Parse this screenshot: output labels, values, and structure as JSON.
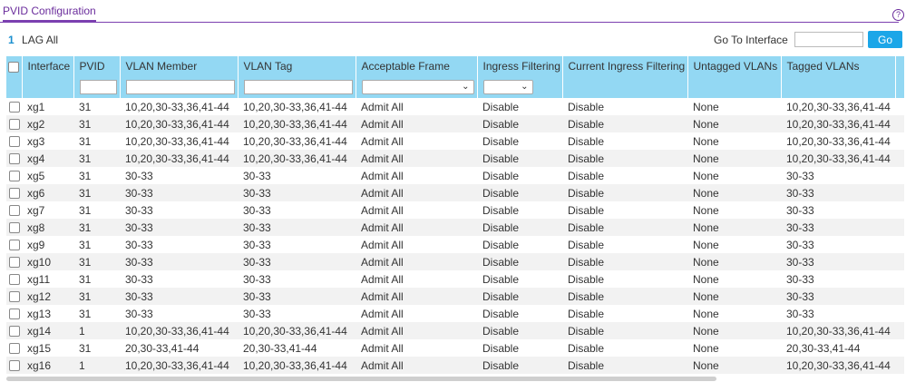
{
  "page": {
    "title": "PVID Configuration",
    "help": "?"
  },
  "nav": {
    "lag_num": "1",
    "lag_label": "LAG All"
  },
  "goto": {
    "label": "Go To Interface",
    "value": "",
    "button": "Go"
  },
  "table": {
    "headers": [
      "Interface",
      "PVID",
      "VLAN Member",
      "VLAN Tag",
      "Acceptable Frame",
      "Ingress Filtering",
      "Current Ingress Filtering",
      "Untagged VLANs",
      "Tagged VLANs"
    ],
    "rows": [
      [
        "xg1",
        "31",
        "10,20,30-33,36,41-44",
        "10,20,30-33,36,41-44",
        "Admit All",
        "Disable",
        "Disable",
        "None",
        "10,20,30-33,36,41-44"
      ],
      [
        "xg2",
        "31",
        "10,20,30-33,36,41-44",
        "10,20,30-33,36,41-44",
        "Admit All",
        "Disable",
        "Disable",
        "None",
        "10,20,30-33,36,41-44"
      ],
      [
        "xg3",
        "31",
        "10,20,30-33,36,41-44",
        "10,20,30-33,36,41-44",
        "Admit All",
        "Disable",
        "Disable",
        "None",
        "10,20,30-33,36,41-44"
      ],
      [
        "xg4",
        "31",
        "10,20,30-33,36,41-44",
        "10,20,30-33,36,41-44",
        "Admit All",
        "Disable",
        "Disable",
        "None",
        "10,20,30-33,36,41-44"
      ],
      [
        "xg5",
        "31",
        "30-33",
        "30-33",
        "Admit All",
        "Disable",
        "Disable",
        "None",
        "30-33"
      ],
      [
        "xg6",
        "31",
        "30-33",
        "30-33",
        "Admit All",
        "Disable",
        "Disable",
        "None",
        "30-33"
      ],
      [
        "xg7",
        "31",
        "30-33",
        "30-33",
        "Admit All",
        "Disable",
        "Disable",
        "None",
        "30-33"
      ],
      [
        "xg8",
        "31",
        "30-33",
        "30-33",
        "Admit All",
        "Disable",
        "Disable",
        "None",
        "30-33"
      ],
      [
        "xg9",
        "31",
        "30-33",
        "30-33",
        "Admit All",
        "Disable",
        "Disable",
        "None",
        "30-33"
      ],
      [
        "xg10",
        "31",
        "30-33",
        "30-33",
        "Admit All",
        "Disable",
        "Disable",
        "None",
        "30-33"
      ],
      [
        "xg11",
        "31",
        "30-33",
        "30-33",
        "Admit All",
        "Disable",
        "Disable",
        "None",
        "30-33"
      ],
      [
        "xg12",
        "31",
        "30-33",
        "30-33",
        "Admit All",
        "Disable",
        "Disable",
        "None",
        "30-33"
      ],
      [
        "xg13",
        "31",
        "30-33",
        "30-33",
        "Admit All",
        "Disable",
        "Disable",
        "None",
        "30-33"
      ],
      [
        "xg14",
        "1",
        "10,20,30-33,36,41-44",
        "10,20,30-33,36,41-44",
        "Admit All",
        "Disable",
        "Disable",
        "None",
        "10,20,30-33,36,41-44"
      ],
      [
        "xg15",
        "31",
        "20,30-33,41-44",
        "20,30-33,41-44",
        "Admit All",
        "Disable",
        "Disable",
        "None",
        "20,30-33,41-44"
      ],
      [
        "xg16",
        "1",
        "10,20,30-33,36,41-44",
        "10,20,30-33,36,41-44",
        "Admit All",
        "Disable",
        "Disable",
        "None",
        "10,20,30-33,36,41-44"
      ]
    ]
  },
  "colors": {
    "accent": "#7b3fb0",
    "header_bg": "#93d8f3",
    "button": "#1ba6e8"
  }
}
